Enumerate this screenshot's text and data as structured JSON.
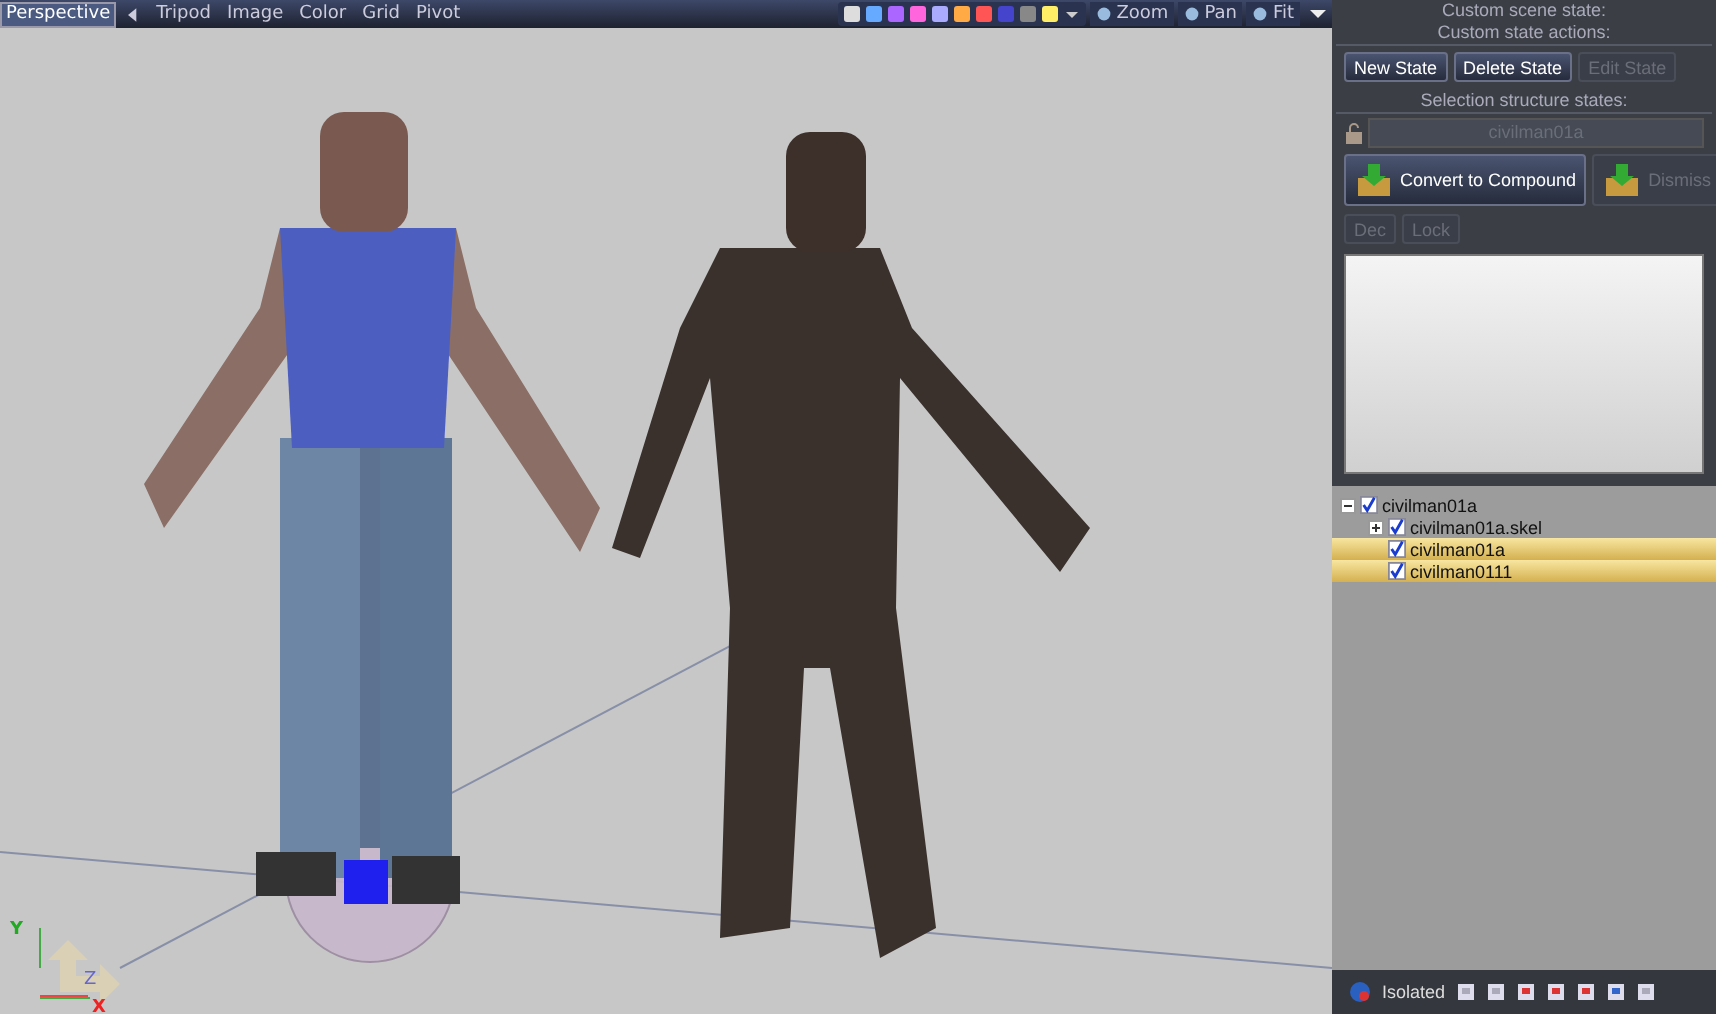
{
  "viewport": {
    "tabs": [
      {
        "label": "Perspective",
        "selected": true
      }
    ],
    "menus": [
      "Tripod",
      "Image",
      "Color",
      "Grid",
      "Pivot"
    ],
    "view_buttons": [
      "Zoom",
      "Pan",
      "Fit"
    ],
    "axes": {
      "y": "Y",
      "z": "Z",
      "x": "X"
    }
  },
  "panel": {
    "cut_heading": "Custom scene state:",
    "actions_heading": "Custom state actions:",
    "state_buttons": [
      {
        "label": "New State",
        "disabled": false
      },
      {
        "label": "Delete State",
        "disabled": false
      },
      {
        "label": "Edit State",
        "disabled": true
      }
    ],
    "structure_heading": "Selection structure states:",
    "structure_field": {
      "value": "civilman01a",
      "disabled": true
    },
    "big_buttons": [
      {
        "label": "Convert to Compound",
        "disabled": false
      },
      {
        "label": "Dismiss",
        "disabled": true
      }
    ],
    "small_buttons": [
      {
        "label": "Dec",
        "disabled": true
      },
      {
        "label": "Lock",
        "disabled": true
      }
    ]
  },
  "tree": [
    {
      "label": "civilman01a",
      "checked": true,
      "expanded": true,
      "selected": false,
      "children": [
        {
          "label": "civilman01a.skel",
          "checked": true,
          "expanded": false,
          "selected": false
        },
        {
          "label": "civilman01a",
          "checked": true,
          "selected": true
        },
        {
          "label": "civilman0111",
          "checked": true,
          "selected": true
        }
      ]
    }
  ],
  "status_bar": {
    "isolated": "Isolated"
  }
}
